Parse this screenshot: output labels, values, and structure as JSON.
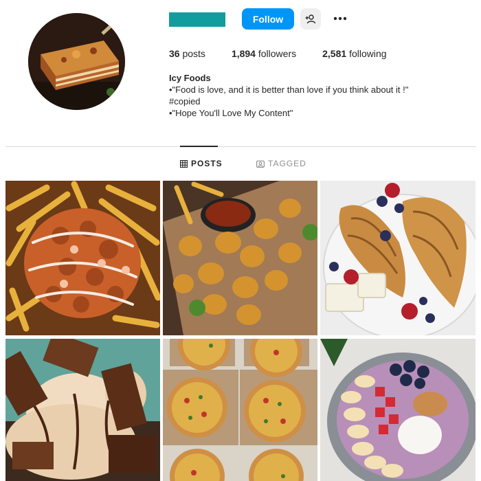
{
  "profile": {
    "follow_label": "Follow",
    "posts_count": "36",
    "posts_label": "posts",
    "followers_count": "1,894",
    "followers_label": "followers",
    "following_count": "2,581",
    "following_label": "following",
    "name": "Icy Foods",
    "bio_lines": [
      "•\"Food is love, and it is better than love if you think about it !\"",
      "#copied",
      "•\"Hope You'll Love My Content\""
    ],
    "username_color": "#129c9e",
    "accent": "#0095f6"
  },
  "tabs": [
    {
      "label": "POSTS",
      "active": true,
      "icon": "grid-icon"
    },
    {
      "label": "TAGGED",
      "active": false,
      "icon": "tagged-icon"
    }
  ],
  "posts": [
    {
      "subject": "loaded fries with fried chicken"
    },
    {
      "subject": "fried chicken nuggets with dip"
    },
    {
      "subject": "croissants with berries and brie"
    },
    {
      "subject": "ice cream with chocolate bars"
    },
    {
      "subject": "pizzas in boxes"
    },
    {
      "subject": "fruit smoothie bowl"
    }
  ]
}
